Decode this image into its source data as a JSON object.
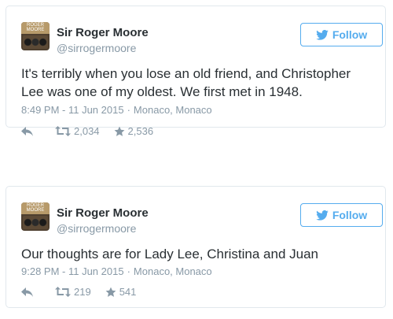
{
  "colors": {
    "accent": "#55acee",
    "muted": "#8899a6",
    "text": "#292f33",
    "border": "#e1e8ed"
  },
  "tweets": [
    {
      "avatar_text": "ROGER MOORE",
      "name": "Sir Roger Moore",
      "handle": "@sirrogermoore",
      "follow_label": "Follow",
      "text": "It's terribly when you lose an old friend, and Christopher Lee was one of my oldest. We first met in 1948.",
      "time": "8:49 PM - 11 Jun 2015",
      "location": "Monaco, Monaco",
      "retweets": "2,034",
      "likes": "2,536",
      "icons": [
        "twitter-bird-icon",
        "reply-icon",
        "retweet-icon",
        "star-icon"
      ]
    },
    {
      "avatar_text": "ROGER MOORE",
      "name": "Sir Roger Moore",
      "handle": "@sirrogermoore",
      "follow_label": "Follow",
      "text": "Our thoughts are for Lady Lee, Christina and Juan",
      "time": "9:28 PM - 11 Jun 2015",
      "location": "Monaco, Monaco",
      "retweets": "219",
      "likes": "541",
      "icons": [
        "twitter-bird-icon",
        "reply-icon",
        "retweet-icon",
        "star-icon"
      ]
    }
  ]
}
